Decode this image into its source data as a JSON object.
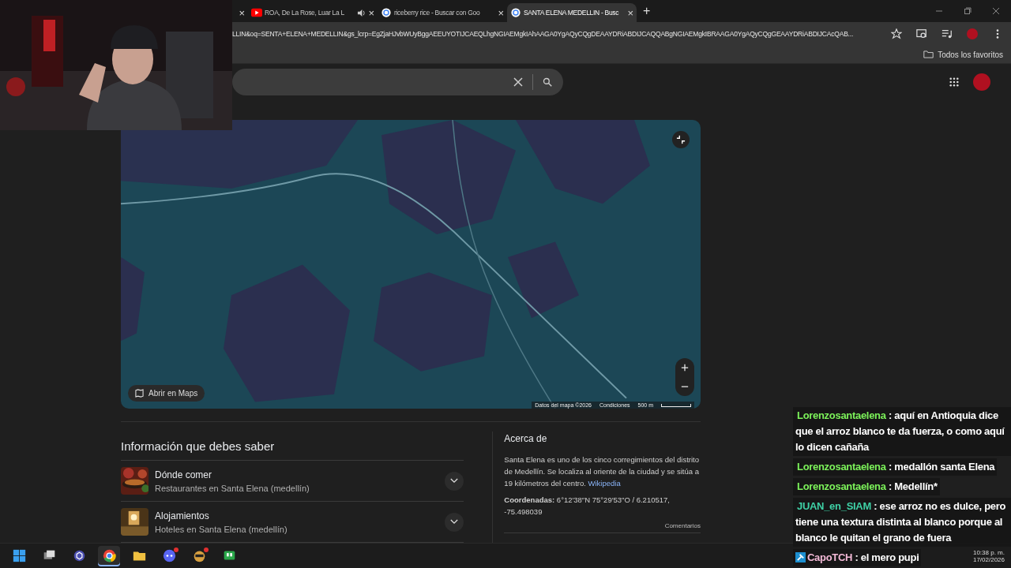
{
  "tabs": [
    {
      "close": "×",
      "selected": false,
      "audio": false
    },
    {
      "kind": "video",
      "title": "ROA, De La Rose, Luar La L",
      "audio": true,
      "close": "×",
      "selected": false
    },
    {
      "kind": "search",
      "title": "riceberry rice - Buscar con Goo",
      "audio": false,
      "close": "×",
      "selected": false
    },
    {
      "kind": "search",
      "title": "SANTA ELENA MEDELLIN - Busc",
      "audio": false,
      "close": "×",
      "selected": true
    }
  ],
  "new_tab": "+",
  "address": {
    "url": "LLIN&oq=SENTA+ELENA+MEDELLIN&gs_lcrp=EgZjaHJvbWUyBggAEEUYOTIJCAEQLhgNGIAEMgkIAhAAGA0YgAQyCQgDEAAYDRiABDIJCAQQABgNGIAEMgkIBRAAGA0YgAQyCQgGEAAYDRiABDIJCAcQAB..."
  },
  "bookmarks": {
    "label": "Todos los favoritos"
  },
  "map": {
    "kind": "picture",
    "open_button": "Abrir en Maps",
    "attribution": "Datos del mapa ©2026",
    "terms": "Condiciones",
    "scale": "500 m"
  },
  "info": {
    "heading": "Información que debes saber",
    "items": [
      {
        "title": "Dónde comer",
        "subtitle": "Restaurantes en Santa Elena (medellín)",
        "expanded": false,
        "kind": "food"
      },
      {
        "title": "Alojamientos",
        "subtitle": "Hoteles en Santa Elena (medellín)",
        "expanded": false,
        "kind": "room"
      }
    ]
  },
  "about": {
    "heading": "Acerca de",
    "text": "Santa Elena es uno de los cinco corregimientos del distrito de Medellín. Se localiza al oriente de la ciudad y se sitúa a 19 kilómetros del centro.",
    "link": "Wikipedia",
    "coords": "**Coordenadas:** 6°12′38″N 75°29′53″O / 6.210517, -75.498039",
    "feedback": "Comentarios"
  },
  "chat": [
    {
      "user": "Lorenzosantaelena",
      "color": "#7cf25a",
      "badge": false,
      "text": ": aquí en Antioquia dice que el arroz blanco te da fuerza, o como aquí lo dicen cañaña"
    },
    {
      "user": "Lorenzosantaelena",
      "color": "#7cf25a",
      "badge": false,
      "text": ": medallón santa Elena"
    },
    {
      "user": "Lorenzosantaelena",
      "color": "#7cf25a",
      "badge": false,
      "text": ": Medellín*"
    },
    {
      "user": "JUAN_en_SIAM",
      "color": "#3fd1a6",
      "badge": false,
      "text": ": ese arroz no es dulce, pero tiene una textura distinta al blanco porque al blanco le quitan el grano de fuera"
    },
    {
      "user": "CapoTCH",
      "color": "#f2b9d6",
      "badge": true,
      "text": ": el mero pupi"
    }
  ],
  "taskbar": {
    "apps": [
      {
        "kind": "windows",
        "active": false,
        "badge": false
      },
      {
        "kind": "taskview",
        "active": false,
        "badge": false
      },
      {
        "kind": "hex",
        "active": false,
        "badge": false
      },
      {
        "kind": "browser",
        "active": true,
        "badge": false
      },
      {
        "kind": "folder",
        "active": false,
        "badge": false
      },
      {
        "kind": "chat",
        "active": false,
        "badge": true
      },
      {
        "kind": "game",
        "active": false,
        "badge": true
      },
      {
        "kind": "green",
        "active": false,
        "badge": false
      }
    ],
    "time": "10:38 p. m.",
    "date": "17/02/2026"
  }
}
